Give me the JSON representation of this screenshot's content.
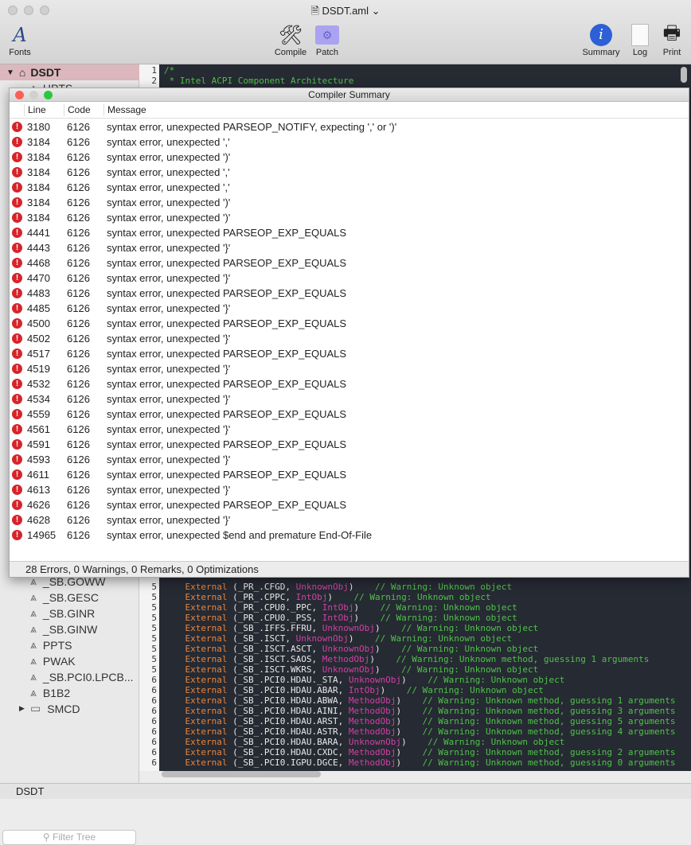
{
  "window": {
    "title": "DSDT.aml"
  },
  "toolbar": {
    "fonts": "Fonts",
    "compile": "Compile",
    "patch": "Patch",
    "summary": "Summary",
    "log": "Log",
    "print": "Print"
  },
  "sidebar": {
    "root": "DSDT",
    "items": [
      "HPTS",
      "_SB.GOWW",
      "_SB.GESC",
      "_SB.GINR",
      "_SB.GINW",
      "PPTS",
      "PWAK",
      "_SB.PCI0.LPCB...",
      "B1B2",
      "SMCD"
    ],
    "filter_placeholder": "Filter Tree"
  },
  "editor": {
    "header": [
      [
        "1",
        "/*"
      ],
      [
        "2",
        " * Intel ACPI Component Architecture"
      ]
    ],
    "lines": [
      [
        "5",
        "_PR_.CFGD",
        "UnknownObj",
        "// Warning: Unknown object"
      ],
      [
        "5",
        "_PR_.CPPC",
        "IntObj",
        "// Warning: Unknown object"
      ],
      [
        "5",
        "_PR_.CPU0._PPC",
        "IntObj",
        "// Warning: Unknown object"
      ],
      [
        "5",
        "_PR_.CPU0._PSS",
        "IntObj",
        "// Warning: Unknown object"
      ],
      [
        "5",
        "_SB_.IFFS.FFRU",
        "UnknownObj",
        "// Warning: Unknown object"
      ],
      [
        "5",
        "_SB_.ISCT",
        "UnknownObj",
        "// Warning: Unknown object"
      ],
      [
        "5",
        "_SB_.ISCT.ASCT",
        "UnknownObj",
        "// Warning: Unknown object"
      ],
      [
        "5",
        "_SB_.ISCT.SAOS",
        "MethodObj",
        "// Warning: Unknown method, guessing 1 arguments"
      ],
      [
        "5",
        "_SB_.ISCT.WKRS",
        "UnknownObj",
        "// Warning: Unknown object"
      ],
      [
        "6",
        "_SB_.PCI0.HDAU._STA",
        "UnknownObj",
        "// Warning: Unknown object"
      ],
      [
        "6",
        "_SB_.PCI0.HDAU.ABAR",
        "IntObj",
        "// Warning: Unknown object"
      ],
      [
        "6",
        "_SB_.PCI0.HDAU.ABWA",
        "MethodObj",
        "// Warning: Unknown method, guessing 1 arguments"
      ],
      [
        "6",
        "_SB_.PCI0.HDAU.AINI",
        "MethodObj",
        "// Warning: Unknown method, guessing 3 arguments"
      ],
      [
        "6",
        "_SB_.PCI0.HDAU.ARST",
        "MethodObj",
        "// Warning: Unknown method, guessing 5 arguments"
      ],
      [
        "6",
        "_SB_.PCI0.HDAU.ASTR",
        "MethodObj",
        "// Warning: Unknown method, guessing 4 arguments"
      ],
      [
        "6",
        "_SB_.PCI0.HDAU.BARA",
        "UnknownObj",
        "// Warning: Unknown object"
      ],
      [
        "6",
        "_SB_.PCI0.HDAU.CXDC",
        "MethodObj",
        "// Warning: Unknown method, guessing 2 arguments"
      ],
      [
        "6",
        "_SB_.PCI0.IGPU.DGCE",
        "MethodObj",
        "// Warning: Unknown method, guessing 0 arguments"
      ]
    ],
    "keyword": "External"
  },
  "summary": {
    "title": "Compiler Summary",
    "columns": [
      "Line",
      "Code",
      "Message"
    ],
    "rows": [
      [
        "3180",
        "6126",
        "syntax error, unexpected PARSEOP_NOTIFY, expecting ',' or ')'"
      ],
      [
        "3184",
        "6126",
        "syntax error, unexpected ','"
      ],
      [
        "3184",
        "6126",
        "syntax error, unexpected ')'"
      ],
      [
        "3184",
        "6126",
        "syntax error, unexpected ','"
      ],
      [
        "3184",
        "6126",
        "syntax error, unexpected ','"
      ],
      [
        "3184",
        "6126",
        "syntax error, unexpected ')'"
      ],
      [
        "3184",
        "6126",
        "syntax error, unexpected ')'"
      ],
      [
        "4441",
        "6126",
        "syntax error, unexpected PARSEOP_EXP_EQUALS"
      ],
      [
        "4443",
        "6126",
        "syntax error, unexpected '}'"
      ],
      [
        "4468",
        "6126",
        "syntax error, unexpected PARSEOP_EXP_EQUALS"
      ],
      [
        "4470",
        "6126",
        "syntax error, unexpected '}'"
      ],
      [
        "4483",
        "6126",
        "syntax error, unexpected PARSEOP_EXP_EQUALS"
      ],
      [
        "4485",
        "6126",
        "syntax error, unexpected '}'"
      ],
      [
        "4500",
        "6126",
        "syntax error, unexpected PARSEOP_EXP_EQUALS"
      ],
      [
        "4502",
        "6126",
        "syntax error, unexpected '}'"
      ],
      [
        "4517",
        "6126",
        "syntax error, unexpected PARSEOP_EXP_EQUALS"
      ],
      [
        "4519",
        "6126",
        "syntax error, unexpected '}'"
      ],
      [
        "4532",
        "6126",
        "syntax error, unexpected PARSEOP_EXP_EQUALS"
      ],
      [
        "4534",
        "6126",
        "syntax error, unexpected '}'"
      ],
      [
        "4559",
        "6126",
        "syntax error, unexpected PARSEOP_EXP_EQUALS"
      ],
      [
        "4561",
        "6126",
        "syntax error, unexpected '}'"
      ],
      [
        "4591",
        "6126",
        "syntax error, unexpected PARSEOP_EXP_EQUALS"
      ],
      [
        "4593",
        "6126",
        "syntax error, unexpected '}'"
      ],
      [
        "4611",
        "6126",
        "syntax error, unexpected PARSEOP_EXP_EQUALS"
      ],
      [
        "4613",
        "6126",
        "syntax error, unexpected '}'"
      ],
      [
        "4626",
        "6126",
        "syntax error, unexpected PARSEOP_EXP_EQUALS"
      ],
      [
        "4628",
        "6126",
        "syntax error, unexpected '}'"
      ],
      [
        "14965",
        "6126",
        "syntax error, unexpected $end and premature End-Of-File"
      ]
    ],
    "footer": "28 Errors, 0 Warnings, 0 Remarks, 0 Optimizations"
  },
  "statusbar": {
    "text": "DSDT"
  },
  "colors": {
    "error": "#d6242b",
    "keyword": "#e8853c",
    "type": "#d43fa7",
    "comment": "#4fc24a",
    "editor_bg": "#262a33"
  }
}
